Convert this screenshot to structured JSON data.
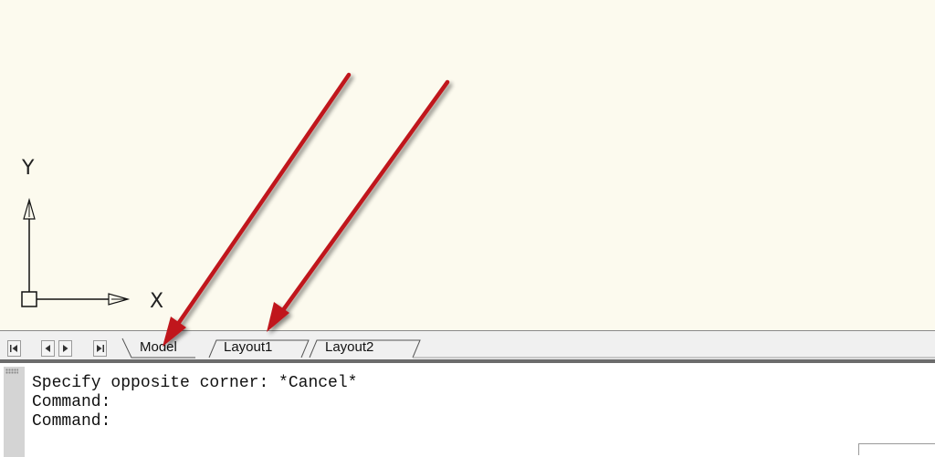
{
  "canvas": {
    "background": "#fcfaee",
    "ucs": {
      "y_label": "Y",
      "x_label": "X",
      "icon": "ucs-axes-icon"
    }
  },
  "navigation": {
    "buttons": [
      {
        "name": "first-tab-button",
        "icon": "first-icon"
      },
      {
        "name": "previous-tab-button",
        "icon": "previous-icon"
      },
      {
        "name": "next-tab-button",
        "icon": "next-icon"
      },
      {
        "name": "last-tab-button",
        "icon": "last-icon"
      }
    ]
  },
  "tabs": [
    {
      "label": "Model",
      "active": true
    },
    {
      "label": "Layout1",
      "active": false
    },
    {
      "label": "Layout2",
      "active": false
    }
  ],
  "command_line": {
    "lines": [
      "Specify opposite corner: *Cancel*",
      "Command:",
      "Command:"
    ]
  },
  "annotations": {
    "arrow_color": "#c0191e",
    "arrows": [
      {
        "points_to": "Model"
      },
      {
        "points_to": "Layout1"
      }
    ]
  }
}
